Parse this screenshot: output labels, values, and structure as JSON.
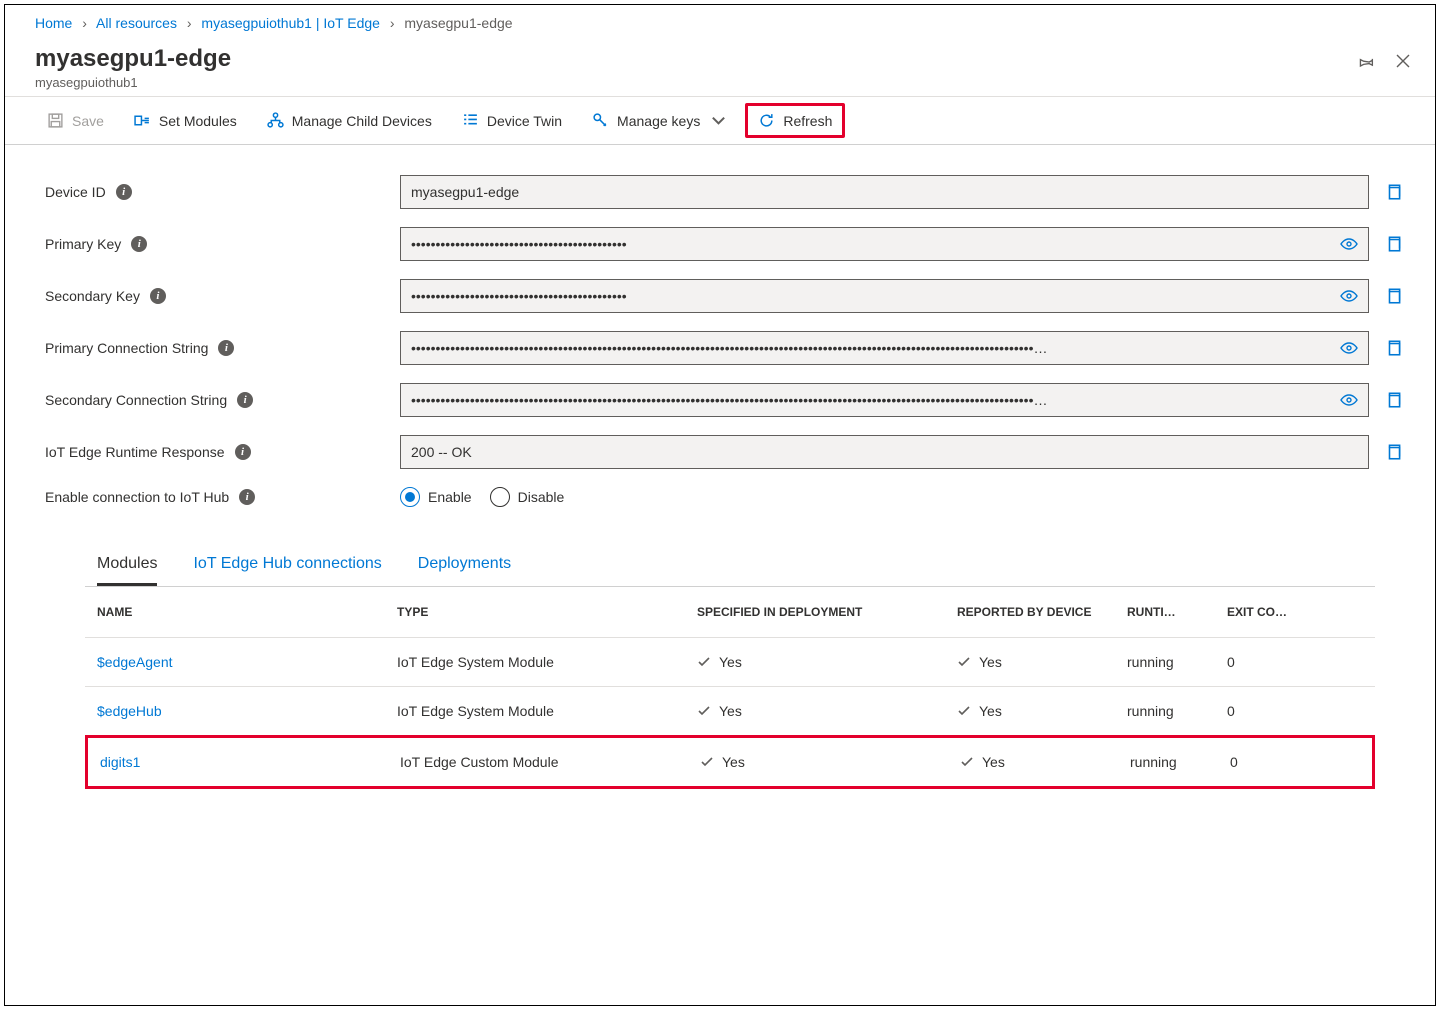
{
  "breadcrumb": {
    "items": [
      "Home",
      "All resources",
      "myasegpuiothub1 | IoT Edge",
      "myasegpu1-edge"
    ]
  },
  "header": {
    "title": "myasegpu1-edge",
    "subtitle": "myasegpuiothub1"
  },
  "toolbar": {
    "save": "Save",
    "set_modules": "Set Modules",
    "manage_child": "Manage Child Devices",
    "device_twin": "Device Twin",
    "manage_keys": "Manage keys",
    "refresh": "Refresh"
  },
  "fields": {
    "device_id": {
      "label": "Device ID",
      "value": "myasegpu1-edge"
    },
    "primary_key": {
      "label": "Primary Key",
      "value": "••••••••••••••••••••••••••••••••••••••••••••"
    },
    "secondary_key": {
      "label": "Secondary Key",
      "value": "••••••••••••••••••••••••••••••••••••••••••••"
    },
    "primary_conn": {
      "label": "Primary Connection String",
      "value": "•••••••••••••••••••••••••••••••••••••••••••••••••••••••••••••••••••••••••••••••••••••••••••••••••••••••••••••••••••••••••••••••…"
    },
    "secondary_conn": {
      "label": "Secondary Connection String",
      "value": "•••••••••••••••••••••••••••••••••••••••••••••••••••••••••••••••••••••••••••••••••••••••••••••••••••••••••••••••••••••••••••••••…"
    },
    "runtime": {
      "label": "IoT Edge Runtime Response",
      "value": "200 -- OK"
    },
    "enable": {
      "label": "Enable connection to IoT Hub",
      "opt_enable": "Enable",
      "opt_disable": "Disable"
    }
  },
  "tabs": {
    "modules": "Modules",
    "connections": "IoT Edge Hub connections",
    "deployments": "Deployments"
  },
  "table": {
    "headers": {
      "name": "NAME",
      "type": "TYPE",
      "spec": "SPECIFIED IN DEPLOYMENT",
      "reported": "REPORTED BY DEVICE",
      "runtime": "RUNTI…",
      "exit": "EXIT CO…"
    },
    "rows": [
      {
        "name": "$edgeAgent",
        "type": "IoT Edge System Module",
        "spec": "Yes",
        "reported": "Yes",
        "runtime": "running",
        "exit": "0",
        "hl": false
      },
      {
        "name": "$edgeHub",
        "type": "IoT Edge System Module",
        "spec": "Yes",
        "reported": "Yes",
        "runtime": "running",
        "exit": "0",
        "hl": false
      },
      {
        "name": "digits1",
        "type": "IoT Edge Custom Module",
        "spec": "Yes",
        "reported": "Yes",
        "runtime": "running",
        "exit": "0",
        "hl": true
      }
    ]
  }
}
